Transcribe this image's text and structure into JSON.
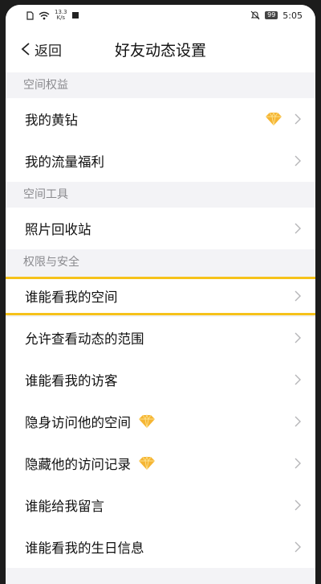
{
  "status_bar": {
    "net_speed_value": "13.3",
    "net_speed_unit": "K/s",
    "battery": "99",
    "time": "5:05"
  },
  "nav": {
    "back_label": "返回",
    "title": "好友动态设置"
  },
  "sections": {
    "benefits": {
      "header": "空间权益",
      "items": [
        "我的黄钻",
        "我的流量福利"
      ]
    },
    "tools": {
      "header": "空间工具",
      "items": [
        "照片回收站"
      ]
    },
    "security": {
      "header": "权限与安全",
      "items": [
        "谁能看我的空间",
        "允许查看动态的范围",
        "谁能看我的访客",
        "隐身访问他的空间",
        "隐藏他的访问记录",
        "谁能给我留言",
        "谁能看我的生日信息"
      ]
    }
  },
  "icons": {
    "diamond": "yellow-diamond-icon",
    "chevron": "chevron-right-icon",
    "back": "chevron-left-icon"
  },
  "colors": {
    "highlight": "#f6c21a",
    "diamond": "#f5b533",
    "section_text": "#8a8a8e"
  }
}
